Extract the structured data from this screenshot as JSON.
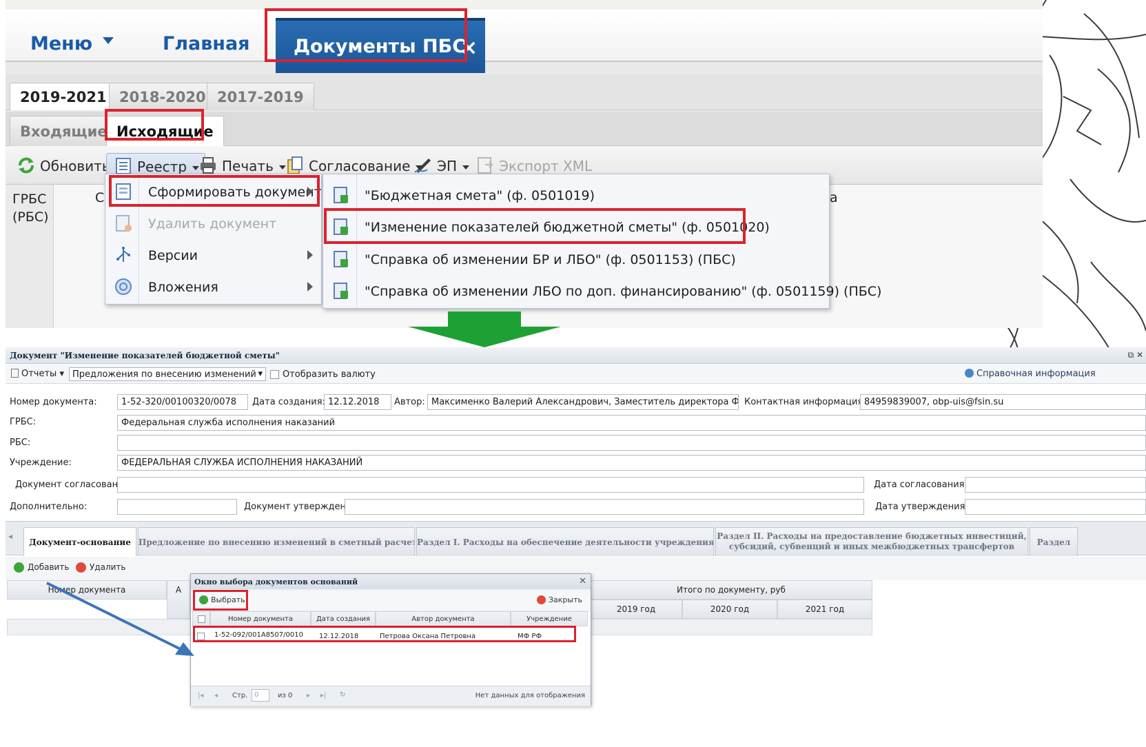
{
  "header": {
    "menu_label": "Меню",
    "main_label": "Главная",
    "active_tab_label": "Документы ПБС",
    "close_glyph": "×"
  },
  "year_tabs": [
    "2019-2021",
    "2018-2020",
    "2017-2019"
  ],
  "direction_tabs": [
    "Входящие",
    "Исходящие"
  ],
  "toolbar": {
    "refresh": "Обновить",
    "registry": "Реестр",
    "print": "Печать",
    "approval": "Согласование",
    "signature": "ЭП",
    "export_xml": "Экспорт XML"
  },
  "grid": {
    "col_grbs": "ГРБС (РБС)",
    "col_c": "С",
    "col_tail": "а"
  },
  "registry_menu": {
    "items": [
      {
        "label": "Сформировать документ",
        "icon": "form-document-icon"
      },
      {
        "label": "Удалить документ",
        "icon": "delete-document-icon"
      },
      {
        "label": "Версии",
        "icon": "versions-icon"
      },
      {
        "label": "Вложения",
        "icon": "attachments-icon"
      }
    ]
  },
  "form_submenu": {
    "items": [
      "\"Бюджетная смета\" (ф. 0501019)",
      "\"Изменение показателей бюджетной сметы\" (ф. 0501020)",
      "\"Справка об изменении БР и ЛБО\" (ф. 0501153) (ПБС)",
      "\"Справка об изменении ЛБО по доп. финансированию\" (ф. 0501159) (ПБС)"
    ]
  },
  "doc": {
    "title": "Документ \"Изменение показателей бюджетной сметы\"",
    "reports": "Отчеты",
    "proposals_select": "Предложения по внесению изменений",
    "show_currency": "Отобразить валюту",
    "reference_info": "Справочная информация",
    "labels": {
      "doc_number": "Номер документа:",
      "created": "Дата создания:",
      "author": "Автор:",
      "contact": "Контактная информация:",
      "grbs": "ГРБС:",
      "rbs": "РБС:",
      "institution": "Учреждение:",
      "agreed": "Документ согласован:",
      "agreed_date": "Дата согласования:",
      "additional": "Дополнительно:",
      "approved": "Документ утвержден:",
      "approved_date": "Дата утверждения:"
    },
    "values": {
      "doc_number": "1-52-320/00100320/0078",
      "created": "12.12.2018",
      "author": "Максименко Валерий Александрович, Заместитель директора ФСИН",
      "contact": "84959839007, obp-uis@fsin.su",
      "grbs": "Федеральная служба исполнения наказаний",
      "rbs": "",
      "institution": "ФЕДЕРАЛЬНАЯ СЛУЖБА ИСПОЛНЕНИЯ НАКАЗАНИЙ"
    },
    "tabs": [
      "Документ-основание",
      "Предложение по внесению изменений в сметный расчет",
      "Раздел I. Расходы на обеспечение деятельности учреждения",
      "Раздел II. Расходы на предоставление бюджетных инвестиций, субсидий, субвенций и иных межбюджетных трансфертов",
      "Раздел"
    ],
    "add": "Добавить",
    "delete": "Удалить",
    "grid": {
      "col_number": "Номер документа",
      "col_a": "А",
      "total": "Итого по документу, руб",
      "years": [
        "2019 год",
        "2020 год",
        "2021 год"
      ]
    }
  },
  "picker": {
    "title": "Окно выбора документов оснований",
    "choose": "Выбрать",
    "close": "Закрыть",
    "columns": [
      "Номер документа",
      "Дата создания",
      "Автор документа",
      "Учреждение"
    ],
    "row": {
      "number": "1-52-092/001А8507/0010",
      "date": "12.12.2018",
      "author": "Петрова Оксана Петровна",
      "institution": "МФ РФ"
    },
    "pager_page": "Стр.",
    "pager_value": "0",
    "pager_of": "из 0",
    "no_data": "Нет данных для отображения"
  },
  "colors": {
    "accent_blue": "#1a5aa8",
    "highlight_red": "#d9232d",
    "arrow_green": "#1ea134",
    "pointer_blue": "#3d74b8"
  }
}
